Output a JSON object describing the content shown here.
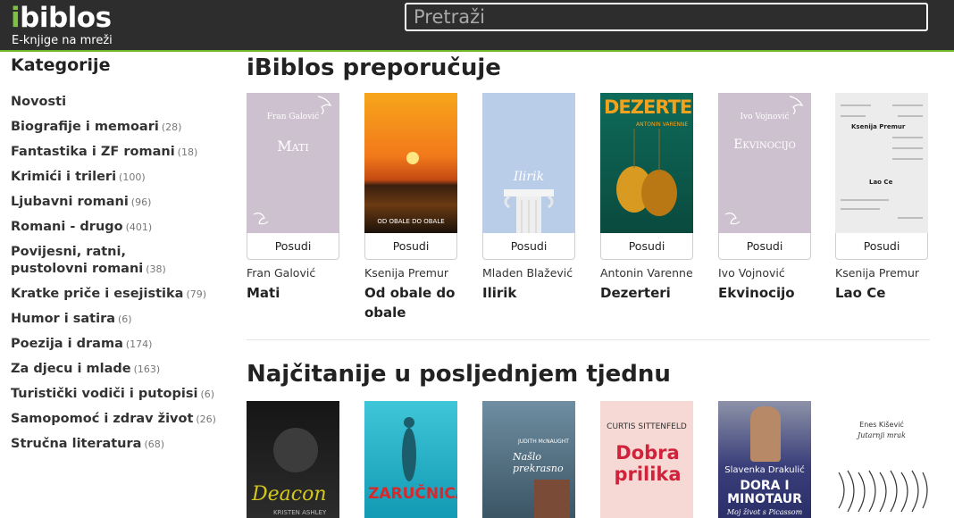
{
  "header": {
    "logo_i": "i",
    "logo_rest": "biblos",
    "tagline": "E-knjige na mreži",
    "search_placeholder": "Pretraži"
  },
  "sidebar": {
    "title": "Kategorije",
    "items": [
      {
        "label": "Novosti",
        "count": ""
      },
      {
        "label": "Biografije i memoari",
        "count": "(28)"
      },
      {
        "label": "Fantastika i ZF romani",
        "count": "(18)"
      },
      {
        "label": "Krimići i trileri",
        "count": "(100)"
      },
      {
        "label": "Ljubavni romani",
        "count": "(96)"
      },
      {
        "label": "Romani - drugo",
        "count": "(401)"
      },
      {
        "label": "Povijesni, ratni, pustolovni romani",
        "count": "(38)"
      },
      {
        "label": "Kratke priče i esejistika",
        "count": "(79)"
      },
      {
        "label": "Humor i satira",
        "count": "(6)"
      },
      {
        "label": "Poezija i drama",
        "count": "(174)"
      },
      {
        "label": "Za djecu i mlade",
        "count": "(163)"
      },
      {
        "label": "Turistički vodiči i putopisi",
        "count": "(6)"
      },
      {
        "label": "Samopomoć i zdrav život",
        "count": "(26)"
      },
      {
        "label": "Stručna literatura",
        "count": "(68)"
      }
    ]
  },
  "recommended": {
    "title": "iBiblos preporučuje",
    "button_label": "Posudi",
    "books": [
      {
        "author": "Fran Galović",
        "title": "Mati",
        "cover_author": "Fran Galović",
        "cover_title": "Mati"
      },
      {
        "author": "Ksenija Premur",
        "title": "Od obale do obale",
        "cover_title": "OD OBALE DO OBALE"
      },
      {
        "author": "Mladen Blažević",
        "title": "Ilirik",
        "cover_title": "Ilirik"
      },
      {
        "author": "Antonin Varenne",
        "title": "Dezerteri",
        "cover_title": "DEZERTERI",
        "cover_author": "ANTONIN VARENNE"
      },
      {
        "author": "Ivo Vojnović",
        "title": "Ekvinocijo",
        "cover_author": "Ivo Vojnović",
        "cover_title": "Ekvinocijo"
      },
      {
        "author": "Ksenija Premur",
        "title": "Lao Ce",
        "cover_author": "Ksenija Premur",
        "cover_title": "Lao Ce"
      }
    ]
  },
  "weekly": {
    "title": "Najčitanije u posljednjem tjednu",
    "covers": [
      {
        "title": "Deacon",
        "author": "KRISTEN ASHLEY"
      },
      {
        "title": "ZARUČNICA"
      },
      {
        "title": "Našlo prekrasno",
        "author": "JUDITH McNAUGHT"
      },
      {
        "title": "Dobra prilika",
        "author": "CURTIS SITTENFELD"
      },
      {
        "title": "DORA I MINOTAUR",
        "author": "Slavenka Drakulić",
        "subtitle": "Moj život s Picassom"
      },
      {
        "title": "Jutarnji mrak",
        "author": "Enes Kišević"
      }
    ]
  },
  "colors": {
    "header_bg": "#2d2d2d",
    "accent_green": "#7cc242"
  }
}
